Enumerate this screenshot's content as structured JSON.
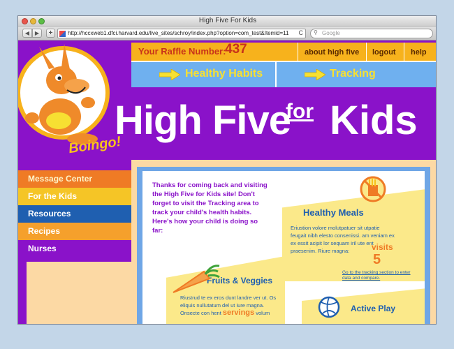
{
  "window": {
    "title": "High Five For Kids",
    "url": "http://hccxweb1.dfci.harvard.edu/live_sites/schroy/index.php?option=com_test&Itemid=11",
    "search_placeholder": "Google",
    "reload_glyph": "C",
    "back_glyph": "◀",
    "forward_glyph": "▶",
    "add_glyph": "+"
  },
  "header": {
    "raffle_label": "Your Raffle Number:",
    "raffle_number": "437",
    "links": [
      "about high five",
      "logout",
      "help"
    ],
    "nav_tabs": [
      "Healthy Habits",
      "Tracking"
    ],
    "mascot_name": "Boingo!",
    "logo_main": "High Five",
    "logo_for": "for",
    "logo_kids": "Kids"
  },
  "sidebar": {
    "items": [
      "Message Center",
      "For the Kids",
      "Resources",
      "Recipes",
      "Nurses"
    ]
  },
  "main": {
    "intro": "Thanks for coming back and visiting the High Five for Kids site! Don't forget to visit the Tracking area to track your child's health habits. Here's how your child is doing so far:",
    "meals": {
      "title": "Healthy Meals",
      "text": "Eriustion volore molutpatuer sit utpatie feugait nibh elesto consenissi. am veniam ex ex essit acipit lor sequam iril ute ent praesenim. Riure magna:",
      "visits_label": "visits",
      "visits_count": "5",
      "link": "Go to the tracking section to enter data and compare."
    },
    "veggies": {
      "title": "Fruits & Veggies",
      "text": "Riustrud te ex eros dunt landre ver ut. Os eliquis nullutatum del ut iure magna. Onsecte con hent",
      "servings_label": "servings",
      "text_after": "volum"
    },
    "active": {
      "title": "Active Play"
    }
  },
  "colors": {
    "purple": "#8a12c9",
    "orange": "#ef7b25",
    "yellow": "#f7b21c",
    "blue": "#6fb0ef",
    "navy": "#1f5fb0"
  }
}
